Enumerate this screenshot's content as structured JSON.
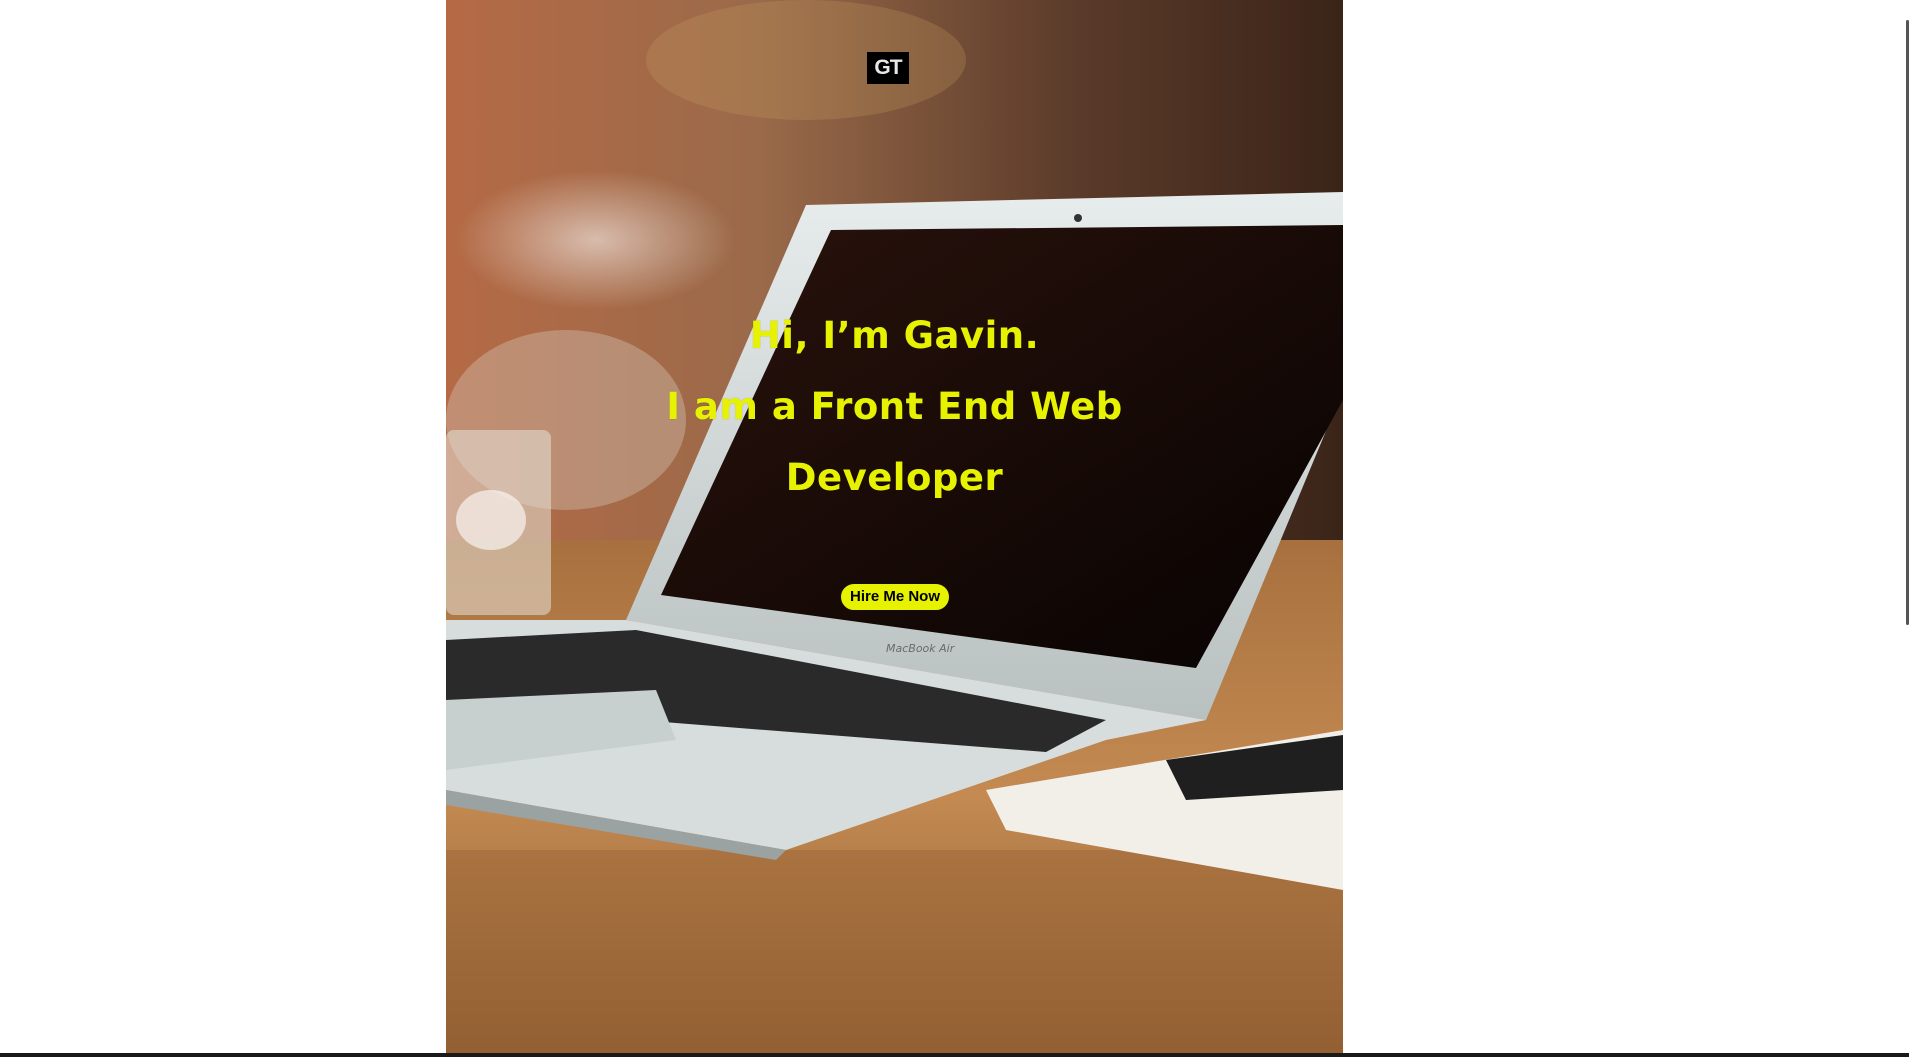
{
  "logo": {
    "text": "GT"
  },
  "hero": {
    "line1": "Hi, I’m Gavin.",
    "line2": "I am a Front End Web",
    "line3": "Developer",
    "cta_label": "Hire Me Now"
  },
  "colors": {
    "accent": "#e6f200",
    "logo_bg": "#000000",
    "page_bg": "#ffffff"
  }
}
